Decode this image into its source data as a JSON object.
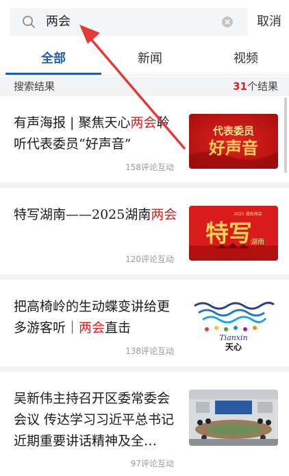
{
  "search": {
    "query": "两会",
    "cancel_label": "取消"
  },
  "tabs": [
    {
      "label": "全部",
      "active": true
    },
    {
      "label": "新闻",
      "active": false
    },
    {
      "label": "视频",
      "active": false
    }
  ],
  "results": {
    "label": "搜索结果",
    "count": "31",
    "count_suffix": "个结果"
  },
  "items": [
    {
      "title_before": "有声海报 | 聚焦天心",
      "title_highlight": "两会",
      "title_after": "聆听代表委员“好声音”",
      "meta": "158评论互动",
      "thumb_text_top": "代表委员",
      "thumb_text_main": "好声音"
    },
    {
      "title_before": "特写湖南——2025湖南",
      "title_highlight": "两会",
      "title_after": "",
      "meta": "120评论互动",
      "thumb_text_small": "2025 湖南两会",
      "thumb_text_main": "特写",
      "thumb_text_sub": "湖南"
    },
    {
      "title_before": "把高椅岭的生动蝶变讲给更多游客听｜",
      "title_highlight": "两会",
      "title_after": "直击",
      "meta": "138评论互动",
      "thumb_text_latin": "Tianxin",
      "thumb_text_cn": "天心"
    },
    {
      "title_before": "吴新伟主持召开区委常委会会议 传达学习习近平总书记近期重要讲话精神及全…",
      "title_highlight": "",
      "title_after": "",
      "meta": "97评论互动"
    }
  ],
  "colors": {
    "accent_blue": "#1f5fae",
    "highlight_red": "#e02020",
    "annotation_red": "#e53935"
  }
}
